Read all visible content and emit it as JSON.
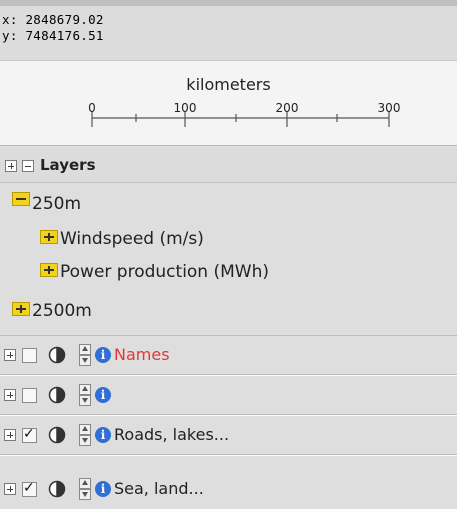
{
  "coordinates": {
    "x_label": "x:",
    "x_value": "2848679.02",
    "y_label": "y:",
    "y_value": "7484176.51"
  },
  "scalebar": {
    "unit": "kilometers",
    "ticks": [
      "0",
      "100",
      "200",
      "300"
    ]
  },
  "layers_panel": {
    "title": "Layers",
    "tree": [
      {
        "label": "250m",
        "expanded": true
      },
      {
        "label": "Windspeed (m/s)",
        "expanded": false
      },
      {
        "label": "Power production (MWh)",
        "expanded": false
      },
      {
        "label": "2500m",
        "expanded": false
      }
    ],
    "overlays": [
      {
        "name": "Names",
        "checked": false,
        "color": "#e03838"
      },
      {
        "name": "",
        "checked": false,
        "color": "#222222"
      },
      {
        "name": "Roads, lakes...",
        "checked": true,
        "color": "#222222"
      },
      {
        "name": "Sea, land...",
        "checked": true,
        "color": "#222222"
      }
    ]
  },
  "colors": {
    "panel_bg": "#dedede",
    "folder": "#f2d21b",
    "info": "#2f6fd6",
    "names_red": "#e03838"
  }
}
